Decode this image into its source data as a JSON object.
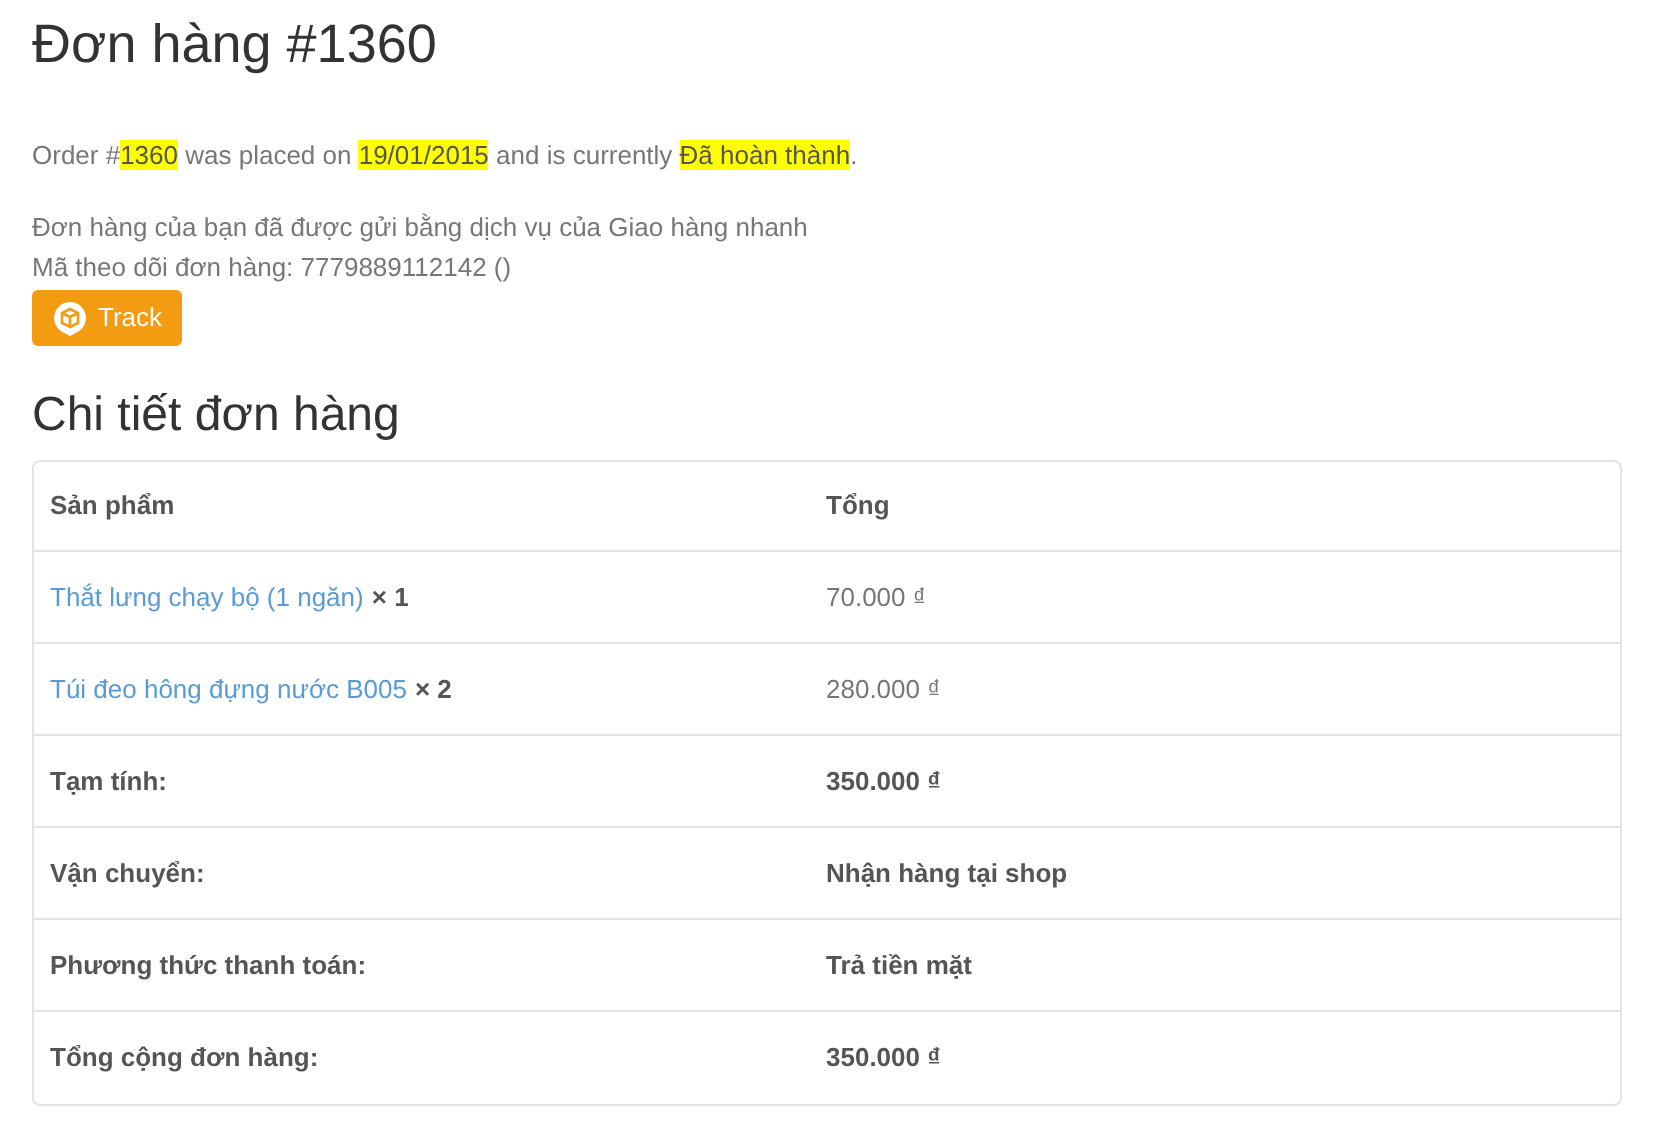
{
  "title": "Đơn hàng #1360",
  "status_sentence": [
    {
      "text": "Order #",
      "highlighted": false
    },
    {
      "text": "1360",
      "highlighted": true
    },
    {
      "text": " was placed on ",
      "highlighted": false
    },
    {
      "text": "19/01/2015",
      "highlighted": true
    },
    {
      "text": " and is currently ",
      "highlighted": false
    },
    {
      "text": "Đã hoàn thành",
      "highlighted": true
    },
    {
      "text": ".",
      "highlighted": false
    }
  ],
  "shipping_note": "Đơn hàng của bạn đã được gửi bằng dịch vụ của Giao hàng nhanh",
  "tracking_code": "Mã theo dõi đơn hàng: 7779889112142 ()",
  "track_button": "Track",
  "details_heading": "Chi tiết đơn hàng",
  "table": {
    "columns": [
      "Sản phẩm",
      "Tổng"
    ],
    "items": [
      {
        "product": "Thắt lưng chạy bộ (1 ngăn)",
        "quantity": "× 1",
        "total": "70.000 ₫"
      },
      {
        "product": "Túi đeo hông đựng nước B005",
        "quantity": "× 2",
        "total": "280.000 ₫"
      }
    ],
    "summary": [
      {
        "label": "Tạm tính:",
        "value": "350.000 ₫"
      },
      {
        "label": "Vận chuyển:",
        "value": "Nhận hàng tại shop"
      },
      {
        "label": "Phương thức thanh toán:",
        "value": "Trả tiền mặt"
      },
      {
        "label": "Tổng cộng đơn hàng:",
        "value": "350.000 ₫"
      }
    ]
  }
}
